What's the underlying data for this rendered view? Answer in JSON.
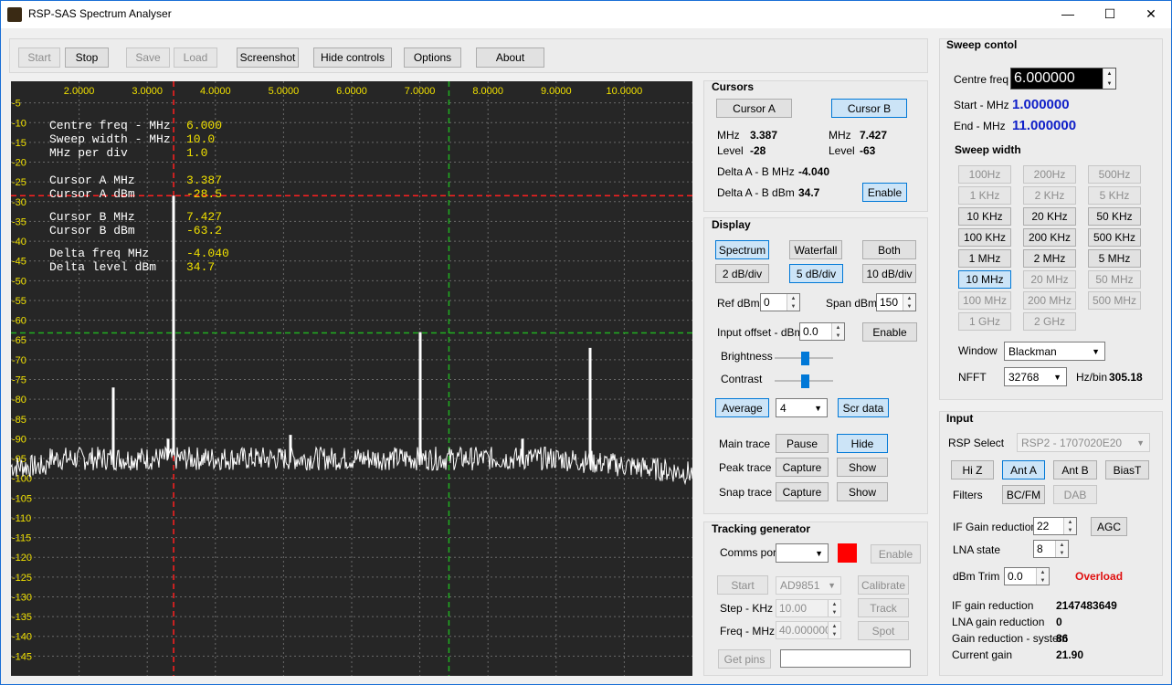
{
  "window": {
    "title": "RSP-SAS Spectrum Analyser",
    "minimize": "—",
    "maximize": "☐",
    "close": "✕"
  },
  "toolbar": {
    "start": "Start",
    "stop": "Stop",
    "save": "Save",
    "load": "Load",
    "screenshot": "Screenshot",
    "hide_controls": "Hide controls",
    "options": "Options",
    "about": "About"
  },
  "chart_data": {
    "type": "line",
    "x_ticks": [
      "2.0000",
      "3.0000",
      "4.0000",
      "5.0000",
      "6.0000",
      "7.0000",
      "8.0000",
      "9.0000",
      "10.0000"
    ],
    "x_tick_values": [
      2,
      3,
      4,
      5,
      6,
      7,
      8,
      9,
      10
    ],
    "xlim": [
      1.0,
      11.0
    ],
    "y_ticks": [
      -5,
      -10,
      -15,
      -20,
      -25,
      -30,
      -35,
      -40,
      -45,
      -50,
      -55,
      -60,
      -65,
      -70,
      -75,
      -80,
      -85,
      -90,
      -95,
      -100,
      -105,
      -110,
      -115,
      -120,
      -125,
      -130,
      -135,
      -140,
      -145
    ],
    "ylim": [
      0,
      -150
    ],
    "noise_floor": -95,
    "peaks": [
      {
        "x": 2.5,
        "y": -77
      },
      {
        "x": 3.3,
        "y": -90
      },
      {
        "x": 3.387,
        "y": -28.5
      },
      {
        "x": 5.1,
        "y": -89
      },
      {
        "x": 7.0,
        "y": -63
      },
      {
        "x": 8.5,
        "y": -90
      },
      {
        "x": 9.5,
        "y": -67
      }
    ],
    "cursor_a": {
      "x": 3.387,
      "y": -28.5,
      "color": "#ff2020"
    },
    "cursor_b": {
      "x": 7.427,
      "y": -63.2,
      "color": "#20b020"
    },
    "trace_color": "#ffffff",
    "tick_color": "#f0e000",
    "grid": true
  },
  "overlay": {
    "rows": [
      {
        "label": "Centre freq - MHz",
        "value": "6.000"
      },
      {
        "label": "Sweep width - MHz",
        "value": "10.0"
      },
      {
        "label": "MHz per div",
        "value": "1.0"
      },
      {
        "label": "Cursor A MHz",
        "value": "3.387"
      },
      {
        "label": "Cursor A dBm",
        "value": "-28.5"
      },
      {
        "label": "Cursor B MHz",
        "value": "7.427"
      },
      {
        "label": "Cursor B dBm",
        "value": "-63.2"
      },
      {
        "label": "Delta freq MHz",
        "value": "-4.040"
      },
      {
        "label": "Delta level dBm",
        "value": "34.7"
      }
    ]
  },
  "cursors": {
    "title": "Cursors",
    "cursor_a": "Cursor A",
    "cursor_b": "Cursor B",
    "mhz_label": "MHz",
    "level_label": "Level",
    "a_mhz": "3.387",
    "a_level": "-28",
    "b_mhz": "7.427",
    "b_level": "-63",
    "delta_mhz_label": "Delta A - B MHz",
    "delta_mhz": "-4.040",
    "delta_dbm_label": "Delta A - B dBm",
    "delta_dbm": "34.7",
    "enable": "Enable"
  },
  "display": {
    "title": "Display",
    "spectrum": "Spectrum",
    "waterfall": "Waterfall",
    "both": "Both",
    "db2": "2 dB/div",
    "db5": "5 dB/div",
    "db10": "10 dB/div",
    "ref_label": "Ref dBm",
    "ref_value": "0",
    "span_label": "Span dBm",
    "span_value": "150",
    "offset_label": "Input offset - dBm",
    "offset_value": "0.0",
    "enable": "Enable",
    "brightness": "Brightness",
    "contrast": "Contrast",
    "brightness_level": 0.5,
    "contrast_level": 0.5,
    "average": "Average",
    "average_value": "4",
    "scr_data": "Scr data",
    "main_trace": "Main trace",
    "pause": "Pause",
    "hide": "Hide",
    "peak_trace": "Peak trace",
    "capture": "Capture",
    "show": "Show",
    "snap_trace": "Snap trace"
  },
  "tracking": {
    "title": "Tracking generator",
    "comms_label": "Comms port",
    "comms_value": "",
    "enable": "Enable",
    "start": "Start",
    "chip": "AD9851",
    "calibrate": "Calibrate",
    "step_label": "Step - KHz",
    "step_value": "10.00",
    "track": "Track",
    "freq_label": "Freq - MHz",
    "freq_value": "40.000000",
    "spot": "Spot",
    "get_pins": "Get pins",
    "pins_value": "",
    "status_color": "#ff0000"
  },
  "sweep": {
    "title": "Sweep contol",
    "centre_label": "Centre freq",
    "centre_value": "6.000000",
    "start_label": "Start - MHz",
    "start_value": "1.000000",
    "end_label": "End - MHz",
    "end_value": "11.000000",
    "width_title": "Sweep width",
    "widths": [
      [
        "100Hz",
        "200Hz",
        "500Hz"
      ],
      [
        "1 KHz",
        "2 KHz",
        "5 KHz"
      ],
      [
        "10 KHz",
        "20 KHz",
        "50 KHz"
      ],
      [
        "100 KHz",
        "200 KHz",
        "500 KHz"
      ],
      [
        "1 MHz",
        "2 MHz",
        "5 MHz"
      ],
      [
        "10 MHz",
        "20 MHz",
        "50 MHz"
      ],
      [
        "100 MHz",
        "200 MHz",
        "500 MHz"
      ],
      [
        "1 GHz",
        "2 GHz",
        ""
      ]
    ],
    "window_label": "Window",
    "window_value": "Blackman",
    "nfft_label": "NFFT",
    "nfft_value": "32768",
    "hzbin_label": "Hz/bin",
    "hzbin_value": "305.18"
  },
  "input": {
    "title": "Input",
    "rsp_label": "RSP Select",
    "rsp_value": "RSP2 - 1707020E20",
    "hiz": "Hi Z",
    "ant_a": "Ant A",
    "ant_b": "Ant B",
    "biast": "BiasT",
    "filters_label": "Filters",
    "bcfm": "BC/FM",
    "dab": "DAB",
    "ifgr_label": "IF Gain reduction",
    "ifgr_value": "22",
    "agc": "AGC",
    "lna_label": "LNA state",
    "lna_value": "8",
    "trim_label": "dBm Trim",
    "trim_value": "0.0",
    "overload": "Overload",
    "if_gain_red_label": "IF gain reduction",
    "if_gain_red_value": "2147483649",
    "lna_gain_red_label": "LNA gain reduction",
    "lna_gain_red_value": "0",
    "sys_gain_red_label": "Gain reduction - system",
    "sys_gain_red_value": "86",
    "current_gain_label": "Current gain",
    "current_gain_value": "21.90"
  }
}
